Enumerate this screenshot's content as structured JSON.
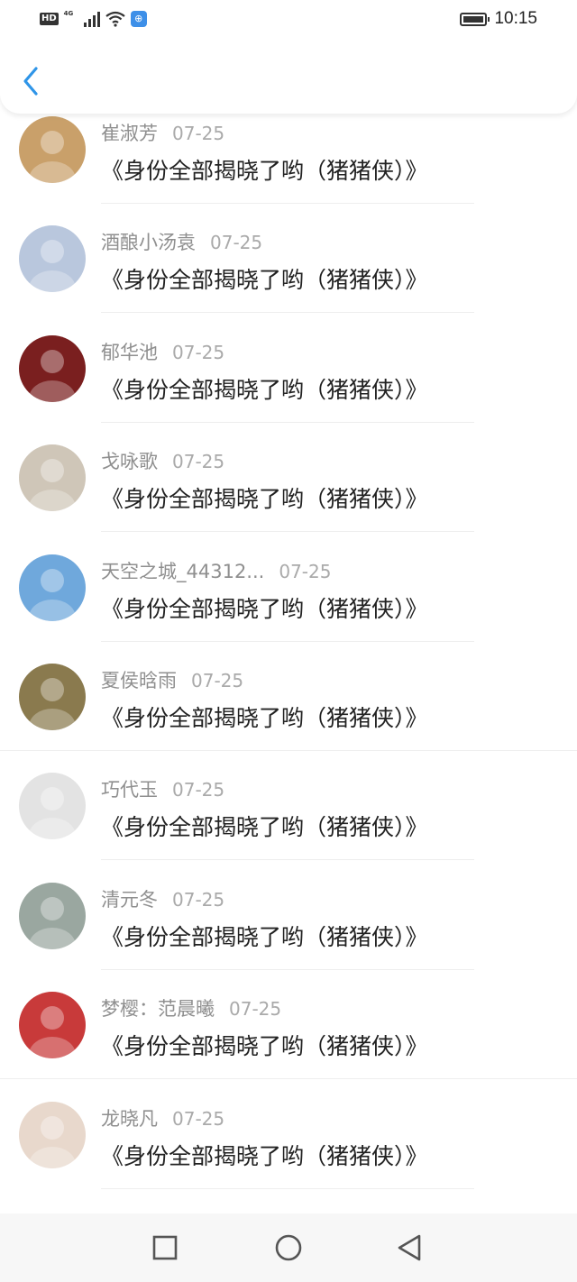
{
  "status_bar": {
    "hd": "HD",
    "network": "4G",
    "time": "10:15"
  },
  "comments": [
    {
      "name": "崔淑芳",
      "date": "07-25",
      "text": "《身份全部揭晓了哟（猪猪侠）》",
      "avatar_color": "#c9a06a"
    },
    {
      "name": "酒酿小汤袁",
      "date": "07-25",
      "text": "《身份全部揭晓了哟（猪猪侠）》",
      "avatar_color": "#b9c7dd"
    },
    {
      "name": "郁华池",
      "date": "07-25",
      "text": "《身份全部揭晓了哟（猪猪侠）》",
      "avatar_color": "#7a1f1f"
    },
    {
      "name": "戈咏歌",
      "date": "07-25",
      "text": "《身份全部揭晓了哟（猪猪侠）》",
      "avatar_color": "#cfc6b8"
    },
    {
      "name": "天空之城_44312...",
      "date": "07-25",
      "text": "《身份全部揭晓了哟（猪猪侠）》",
      "avatar_color": "#6fa8dc"
    },
    {
      "name": "夏侯晗雨",
      "date": "07-25",
      "text": "《身份全部揭晓了哟（猪猪侠）》",
      "avatar_color": "#8a7a4e"
    },
    {
      "name": "巧代玉",
      "date": "07-25",
      "text": "《身份全部揭晓了哟（猪猪侠）》",
      "avatar_color": "#e3e3e3"
    },
    {
      "name": "清元冬",
      "date": "07-25",
      "text": "《身份全部揭晓了哟（猪猪侠）》",
      "avatar_color": "#9aa7a0"
    },
    {
      "name": "梦樱：范晨曦",
      "date": "07-25",
      "text": "《身份全部揭晓了哟（猪猪侠）》",
      "avatar_color": "#c83a3a"
    },
    {
      "name": "龙晓凡",
      "date": "07-25",
      "text": "《身份全部揭晓了哟（猪猪侠）》",
      "avatar_color": "#e8d8cc"
    }
  ],
  "nav": {
    "recent_icon": "square-icon",
    "home_icon": "circle-icon",
    "back_icon": "triangle-back-icon"
  },
  "colors": {
    "accent": "#2f95e8",
    "name_text": "#8f8f8f",
    "date_text": "#aaaaaa",
    "content_text": "#222222"
  }
}
